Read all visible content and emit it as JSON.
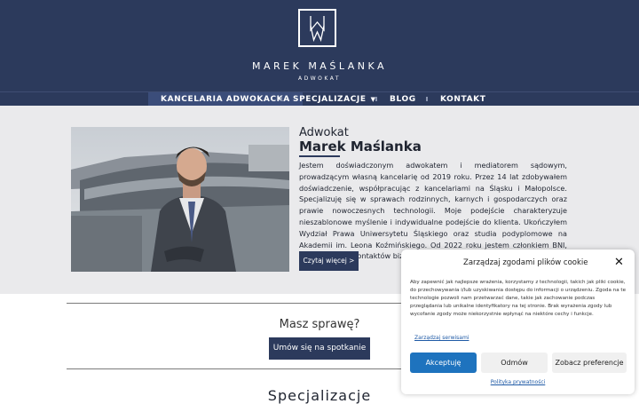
{
  "header": {
    "logo_monogram": "MM",
    "brand_name": "MAREK MAŚLANKA",
    "brand_sub": "ADWOKAT"
  },
  "nav": {
    "items": [
      {
        "label": "KANCELARIA ADWOKACKA",
        "active": true
      },
      {
        "label": "SPECJALIZACJE",
        "has_dropdown": true
      },
      {
        "label": "BLOG"
      },
      {
        "label": "KONTAKT"
      }
    ]
  },
  "intro": {
    "title": "Adwokat",
    "name": "Marek Maślanka",
    "text": "Jestem doświadczonym adwokatem i mediatorem sądowym, prowadzącym własną kancelarię od 2019 roku. Przez 14 lat zdobywałem doświadczenie, współpracując z kancelariami na Śląsku i Małopolsce. Specjalizuję się w sprawach rodzinnych, karnych i gospodarczych oraz prawie nowoczesnych technologii. Moje podejście charakteryzuje nieszablonowe myślenie i indywidualne podejście do klienta. Ukończyłem Wydział Prawa Uniwersytetu Śląskiego oraz studia podyplomowe na Akademii im. Leona Koźmińskiego. Od 2022 roku jestem członkiem BNI, rozwijając sieć kontaktów biznesowych.",
    "read_more": "Czytaj więcej >"
  },
  "cta": {
    "question": "Masz sprawę?",
    "button": "Umów się na spotkanie"
  },
  "section": {
    "title": "Specjalizacje"
  },
  "cookie": {
    "title": "Zarządzaj zgodami plików cookie",
    "close_icon": "close-icon",
    "text": "Aby zapewnić jak najlepsze wrażenia, korzystamy z technologii, takich jak pliki cookie, do przechowywania i/lub uzyskiwania dostępu do informacji o urządzeniu. Zgoda na te technologie pozwoli nam przetwarzać dane, takie jak zachowanie podczas przeglądania lub unikalne identyfikatory na tej stronie. Brak wyrażenia zgody lub wycofanie zgody może niekorzystnie wpłynąć na niektóre cechy i funkcje.",
    "manage_services": "Zarządzaj serwisami",
    "accept": "Akceptuję",
    "deny": "Odmów",
    "preferences": "Zobacz preferencje",
    "privacy_policy": "Polityka prywatności"
  },
  "colors": {
    "navy": "#2c3a5c",
    "accept_blue": "#1e73be",
    "hero_bg": "#eaeaec"
  }
}
